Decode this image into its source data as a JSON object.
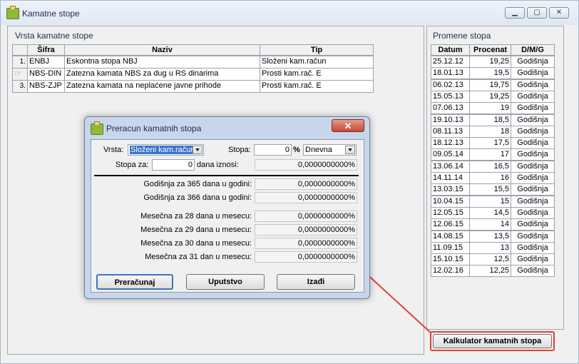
{
  "window": {
    "title": "Kamatne stope"
  },
  "left_panel": {
    "title": "Vrsta kamatne stope",
    "columns": [
      "Šifra",
      "Naziv",
      "Tip"
    ],
    "rows": [
      {
        "marker": "1.",
        "sifra": "ENBJ",
        "naziv": "Eskontna stopa NBJ",
        "tip": "Složeni kam.račun"
      },
      {
        "marker": "",
        "sifra": "NBS-DIN",
        "naziv": "Zatezna kamata NBS za dug u RS dinarima",
        "tip": "Prosti kam.rač. E"
      },
      {
        "marker": "3.",
        "sifra": "NBS-ZJP",
        "naziv": "Zatezna kamata na neplaćene javne prihode",
        "tip": "Prosti kam.rač. E"
      }
    ]
  },
  "right_panel": {
    "title": "Promene stopa",
    "columns": [
      "Datum",
      "Procenat",
      "D/M/G"
    ],
    "rows": [
      [
        "25.12.12",
        "19,25",
        "Godišnja"
      ],
      [
        "18.01.13",
        "19,5",
        "Godišnja"
      ],
      [
        "06.02.13",
        "19,75",
        "Godišnja"
      ],
      [
        "15.05.13",
        "19,25",
        "Godišnja"
      ],
      [
        "07.06.13",
        "19",
        "Godišnja"
      ],
      [
        "19.10.13",
        "18,5",
        "Godišnja"
      ],
      [
        "08.11.13",
        "18",
        "Godišnja"
      ],
      [
        "18.12.13",
        "17,5",
        "Godišnja"
      ],
      [
        "09.05.14",
        "17",
        "Godišnja"
      ],
      [
        "13.06.14",
        "16,5",
        "Godišnja"
      ],
      [
        "14.11.14",
        "16",
        "Godišnja"
      ],
      [
        "13.03.15",
        "15,5",
        "Godišnja"
      ],
      [
        "10.04.15",
        "15",
        "Godišnja"
      ],
      [
        "12.05.15",
        "14,5",
        "Godišnja"
      ],
      [
        "12.06.15",
        "14",
        "Godišnja"
      ],
      [
        "14.08.15",
        "13,5",
        "Godišnja"
      ],
      [
        "11.09.15",
        "13",
        "Godišnja"
      ],
      [
        "15.10.15",
        "12,5",
        "Godišnja"
      ],
      [
        "12.02.16",
        "12,25",
        "Godišnja"
      ]
    ],
    "calc_button": "Kalkulator kamatnih stopa"
  },
  "dialog": {
    "title": "Preracun kamatnih stopa",
    "close": "✕",
    "vrsta_label": "Vrsta:",
    "vrsta_value": "Složeni kam.račun",
    "stopa_label": "Stopa:",
    "stopa_value": "0",
    "percent": "%",
    "period_value": "Dnevna",
    "stopa_za_label": "Stopa za:",
    "stopa_za_value": "0",
    "dana_iznosi": "dana iznosi:",
    "dana_iznosi_value": "0,0000000000%",
    "results": [
      {
        "label": "Godišnja za 365 dana u godini:",
        "value": "0,0000000000%"
      },
      {
        "label": "Godišnja za 366 dana u godini:",
        "value": "0,0000000000%"
      },
      {
        "label": "Mesečna za 28 dana u mesecu:",
        "value": "0,0000000000%"
      },
      {
        "label": "Mesečna za 29 dana u mesecu:",
        "value": "0,0000000000%"
      },
      {
        "label": "Mesečna za 30 dana u mesecu:",
        "value": "0,0000000000%"
      },
      {
        "label": "Mesečna za 31 dan u mesecu:",
        "value": "0,0000000000%"
      }
    ],
    "buttons": {
      "preracunaj": "Preračunaj",
      "uputstvo": "Uputstvo",
      "izadji": "Izađi"
    }
  },
  "colors": {
    "annotation": "#e0403a",
    "dialog_frame": "#c7d6ea"
  },
  "icons": {
    "window": "app-folder-icon",
    "dialog": "app-folder-icon"
  }
}
